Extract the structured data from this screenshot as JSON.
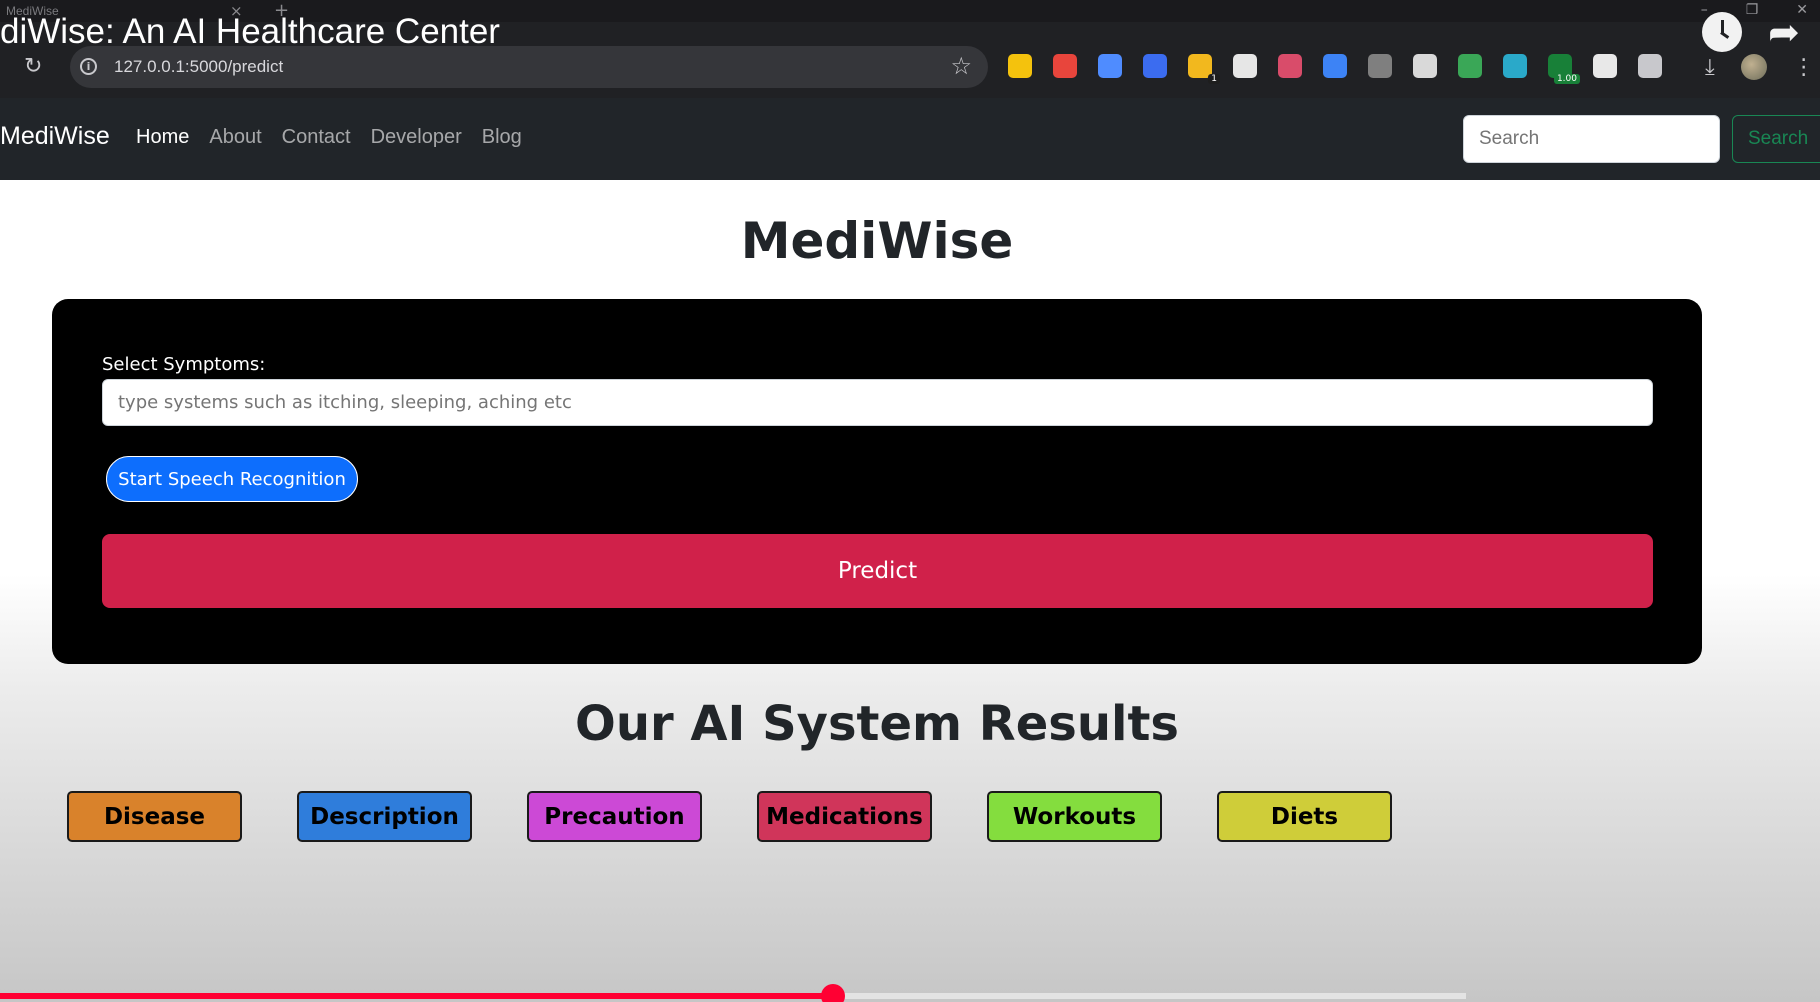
{
  "browser": {
    "tab_title": "MediWise",
    "video_title": "diWise: An AI Healthcare Center",
    "url": "127.0.0.1:5000/predict",
    "extensions": [
      {
        "name": "ext-a-icon",
        "color": "#f4c20d"
      },
      {
        "name": "ext-shield-icon",
        "color": "#e8453c"
      },
      {
        "name": "ext-pen-icon",
        "color": "#4f8cff"
      },
      {
        "name": "ext-arrow-icon",
        "color": "#3b6cf0"
      },
      {
        "name": "ext-bulb-icon",
        "color": "#f2b81e",
        "badge": "1"
      },
      {
        "name": "ext-omega-icon",
        "color": "#e6e6e6"
      },
      {
        "name": "ext-colorwheel-icon",
        "color": "#d94c6a"
      },
      {
        "name": "ext-swirl-icon",
        "color": "#3d83f5"
      },
      {
        "name": "ext-puzzle-grey-icon",
        "color": "#7f7f7f"
      },
      {
        "name": "ext-gauge-icon",
        "color": "#d9d9d9"
      },
      {
        "name": "ext-robot-icon",
        "color": "#3aa757"
      },
      {
        "name": "ext-globe-icon",
        "color": "#2aa9c9"
      },
      {
        "name": "ext-speed-icon",
        "color": "#188038",
        "badge": "1.00"
      },
      {
        "name": "ext-lh-icon",
        "color": "#e8e8e8"
      },
      {
        "name": "ext-extensions-icon",
        "color": "#c8c8cc"
      }
    ]
  },
  "navbar": {
    "brand": "MediWise",
    "links": [
      "Home",
      "About",
      "Contact",
      "Developer",
      "Blog"
    ],
    "search_placeholder": "Search",
    "search_button": "Search"
  },
  "main": {
    "title": "MediWise",
    "symptoms_label": "Select Symptoms:",
    "symptoms_placeholder": "type systems such as itching, sleeping, aching etc",
    "speech_button": "Start Speech Recognition",
    "predict_button": "Predict",
    "results_title": "Our AI System Results",
    "result_buttons": [
      {
        "label": "Disease",
        "color": "#d9822b"
      },
      {
        "label": "Description",
        "color": "#2f7ddb"
      },
      {
        "label": "Precaution",
        "color": "#cc49d6"
      },
      {
        "label": "Medications",
        "color": "#d0355a"
      },
      {
        "label": "Workouts",
        "color": "#84dd3e"
      },
      {
        "label": "Diets",
        "color": "#cfcd39"
      }
    ]
  },
  "video_progress": 0.568
}
